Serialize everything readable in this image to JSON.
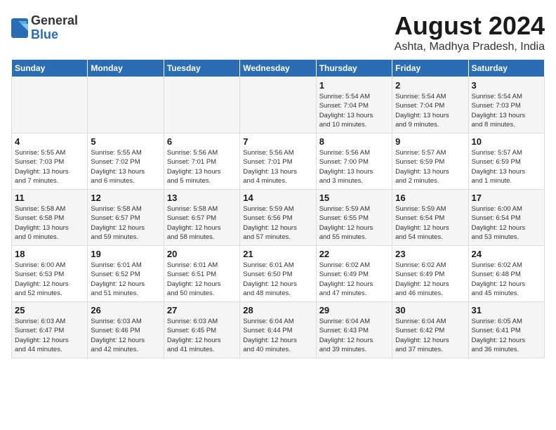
{
  "logo": {
    "general": "General",
    "blue": "Blue"
  },
  "title": "August 2024",
  "subtitle": "Ashta, Madhya Pradesh, India",
  "days_header": [
    "Sunday",
    "Monday",
    "Tuesday",
    "Wednesday",
    "Thursday",
    "Friday",
    "Saturday"
  ],
  "weeks": [
    [
      {
        "day": "",
        "content": ""
      },
      {
        "day": "",
        "content": ""
      },
      {
        "day": "",
        "content": ""
      },
      {
        "day": "",
        "content": ""
      },
      {
        "day": "1",
        "content": "Sunrise: 5:54 AM\nSunset: 7:04 PM\nDaylight: 13 hours\nand 10 minutes."
      },
      {
        "day": "2",
        "content": "Sunrise: 5:54 AM\nSunset: 7:04 PM\nDaylight: 13 hours\nand 9 minutes."
      },
      {
        "day": "3",
        "content": "Sunrise: 5:54 AM\nSunset: 7:03 PM\nDaylight: 13 hours\nand 8 minutes."
      }
    ],
    [
      {
        "day": "4",
        "content": "Sunrise: 5:55 AM\nSunset: 7:03 PM\nDaylight: 13 hours\nand 7 minutes."
      },
      {
        "day": "5",
        "content": "Sunrise: 5:55 AM\nSunset: 7:02 PM\nDaylight: 13 hours\nand 6 minutes."
      },
      {
        "day": "6",
        "content": "Sunrise: 5:56 AM\nSunset: 7:01 PM\nDaylight: 13 hours\nand 5 minutes."
      },
      {
        "day": "7",
        "content": "Sunrise: 5:56 AM\nSunset: 7:01 PM\nDaylight: 13 hours\nand 4 minutes."
      },
      {
        "day": "8",
        "content": "Sunrise: 5:56 AM\nSunset: 7:00 PM\nDaylight: 13 hours\nand 3 minutes."
      },
      {
        "day": "9",
        "content": "Sunrise: 5:57 AM\nSunset: 6:59 PM\nDaylight: 13 hours\nand 2 minutes."
      },
      {
        "day": "10",
        "content": "Sunrise: 5:57 AM\nSunset: 6:59 PM\nDaylight: 13 hours\nand 1 minute."
      }
    ],
    [
      {
        "day": "11",
        "content": "Sunrise: 5:58 AM\nSunset: 6:58 PM\nDaylight: 13 hours\nand 0 minutes."
      },
      {
        "day": "12",
        "content": "Sunrise: 5:58 AM\nSunset: 6:57 PM\nDaylight: 12 hours\nand 59 minutes."
      },
      {
        "day": "13",
        "content": "Sunrise: 5:58 AM\nSunset: 6:57 PM\nDaylight: 12 hours\nand 58 minutes."
      },
      {
        "day": "14",
        "content": "Sunrise: 5:59 AM\nSunset: 6:56 PM\nDaylight: 12 hours\nand 57 minutes."
      },
      {
        "day": "15",
        "content": "Sunrise: 5:59 AM\nSunset: 6:55 PM\nDaylight: 12 hours\nand 55 minutes."
      },
      {
        "day": "16",
        "content": "Sunrise: 5:59 AM\nSunset: 6:54 PM\nDaylight: 12 hours\nand 54 minutes."
      },
      {
        "day": "17",
        "content": "Sunrise: 6:00 AM\nSunset: 6:54 PM\nDaylight: 12 hours\nand 53 minutes."
      }
    ],
    [
      {
        "day": "18",
        "content": "Sunrise: 6:00 AM\nSunset: 6:53 PM\nDaylight: 12 hours\nand 52 minutes."
      },
      {
        "day": "19",
        "content": "Sunrise: 6:01 AM\nSunset: 6:52 PM\nDaylight: 12 hours\nand 51 minutes."
      },
      {
        "day": "20",
        "content": "Sunrise: 6:01 AM\nSunset: 6:51 PM\nDaylight: 12 hours\nand 50 minutes."
      },
      {
        "day": "21",
        "content": "Sunrise: 6:01 AM\nSunset: 6:50 PM\nDaylight: 12 hours\nand 48 minutes."
      },
      {
        "day": "22",
        "content": "Sunrise: 6:02 AM\nSunset: 6:49 PM\nDaylight: 12 hours\nand 47 minutes."
      },
      {
        "day": "23",
        "content": "Sunrise: 6:02 AM\nSunset: 6:49 PM\nDaylight: 12 hours\nand 46 minutes."
      },
      {
        "day": "24",
        "content": "Sunrise: 6:02 AM\nSunset: 6:48 PM\nDaylight: 12 hours\nand 45 minutes."
      }
    ],
    [
      {
        "day": "25",
        "content": "Sunrise: 6:03 AM\nSunset: 6:47 PM\nDaylight: 12 hours\nand 44 minutes."
      },
      {
        "day": "26",
        "content": "Sunrise: 6:03 AM\nSunset: 6:46 PM\nDaylight: 12 hours\nand 42 minutes."
      },
      {
        "day": "27",
        "content": "Sunrise: 6:03 AM\nSunset: 6:45 PM\nDaylight: 12 hours\nand 41 minutes."
      },
      {
        "day": "28",
        "content": "Sunrise: 6:04 AM\nSunset: 6:44 PM\nDaylight: 12 hours\nand 40 minutes."
      },
      {
        "day": "29",
        "content": "Sunrise: 6:04 AM\nSunset: 6:43 PM\nDaylight: 12 hours\nand 39 minutes."
      },
      {
        "day": "30",
        "content": "Sunrise: 6:04 AM\nSunset: 6:42 PM\nDaylight: 12 hours\nand 37 minutes."
      },
      {
        "day": "31",
        "content": "Sunrise: 6:05 AM\nSunset: 6:41 PM\nDaylight: 12 hours\nand 36 minutes."
      }
    ]
  ]
}
